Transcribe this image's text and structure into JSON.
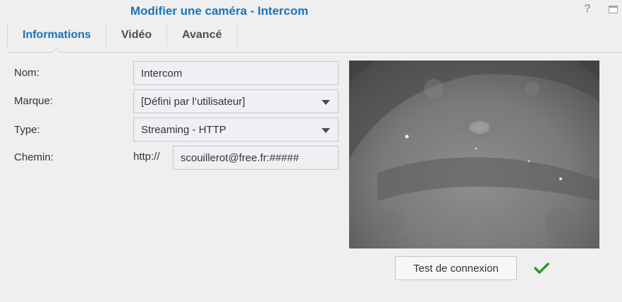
{
  "window": {
    "title": "Modifier une caméra - Intercom",
    "help_glyph": "?",
    "icons": [
      "help-icon",
      "minimize-icon"
    ]
  },
  "tabs": [
    {
      "label": "Informations",
      "active": true
    },
    {
      "label": "Vidéo",
      "active": false
    },
    {
      "label": "Avancé",
      "active": false
    }
  ],
  "form": {
    "name": {
      "label": "Nom:",
      "value": "Intercom"
    },
    "brand": {
      "label": "Marque:",
      "value": "[Défini par l’utilisateur]"
    },
    "type": {
      "label": "Type:",
      "value": "Streaming - HTTP"
    },
    "path": {
      "label": "Chemin:",
      "prefix": "http://",
      "value": "scouillerot@free.fr:#####"
    }
  },
  "preview": {
    "description_icon": "camera-preview-image"
  },
  "test_button": {
    "label": "Test de connexion"
  },
  "status": {
    "icon": "check-icon",
    "color": "#2a9a2a"
  },
  "colors": {
    "accent": "#1a73b8",
    "background": "#efefef"
  }
}
